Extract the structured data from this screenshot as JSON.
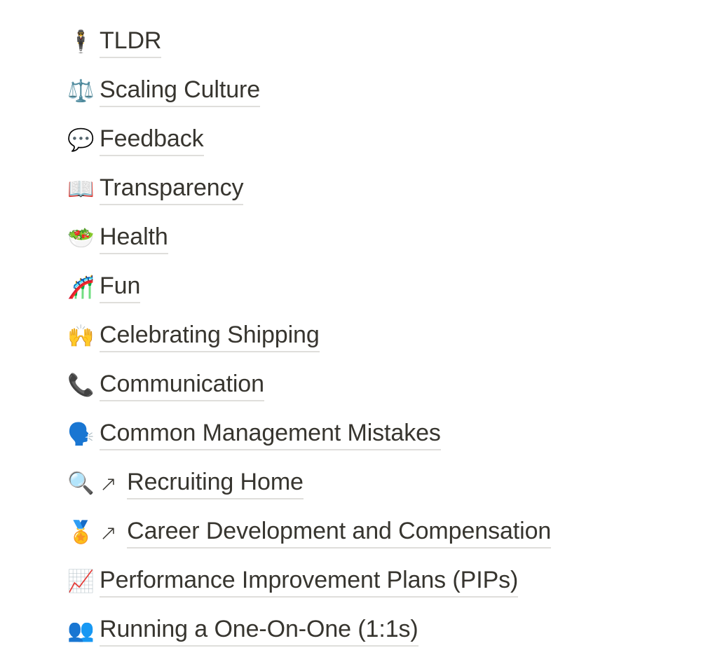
{
  "page": {
    "background_color": "#ffffff",
    "text_color": "#37352f",
    "underline_color": "#dfdedb",
    "external_link_arrow": "↗"
  },
  "toc": {
    "items": [
      {
        "emoji": "🕴️",
        "icon_name": "person-in-suit-levitating-emoji",
        "label": "TLDR",
        "external": false
      },
      {
        "emoji": "⚖️",
        "icon_name": "balance-scale-emoji",
        "label": "Scaling Culture",
        "external": false
      },
      {
        "emoji": "💬",
        "icon_name": "speech-balloon-emoji",
        "label": "Feedback",
        "external": false
      },
      {
        "emoji": "📖",
        "icon_name": "open-book-emoji",
        "label": "Transparency",
        "external": false
      },
      {
        "emoji": "🥗",
        "icon_name": "green-salad-emoji",
        "label": "Health",
        "external": false
      },
      {
        "emoji": "🎢",
        "icon_name": "roller-coaster-emoji",
        "label": "Fun",
        "external": false
      },
      {
        "emoji": "🙌",
        "icon_name": "raising-hands-emoji",
        "label": "Celebrating Shipping",
        "external": false
      },
      {
        "emoji": "📞",
        "icon_name": "telephone-receiver-emoji",
        "label": "Communication",
        "external": false
      },
      {
        "emoji": "🗣️",
        "icon_name": "speaking-head-emoji",
        "label": "Common Management Mistakes",
        "external": false
      },
      {
        "emoji": "🔍",
        "icon_name": "magnifying-glass-emoji",
        "label": "Recruiting Home",
        "external": true,
        "arrow": "↗"
      },
      {
        "emoji": "🏅",
        "icon_name": "sports-medal-emoji",
        "label": "Career Development and Compensation",
        "external": true,
        "arrow": "↗"
      },
      {
        "emoji": "📈",
        "icon_name": "chart-increasing-emoji",
        "label": "Performance Improvement Plans (PIPs)",
        "external": false
      },
      {
        "emoji": "👥",
        "icon_name": "busts-in-silhouette-emoji",
        "label": "Running a One-On-One (1:1s)",
        "external": false
      }
    ]
  }
}
